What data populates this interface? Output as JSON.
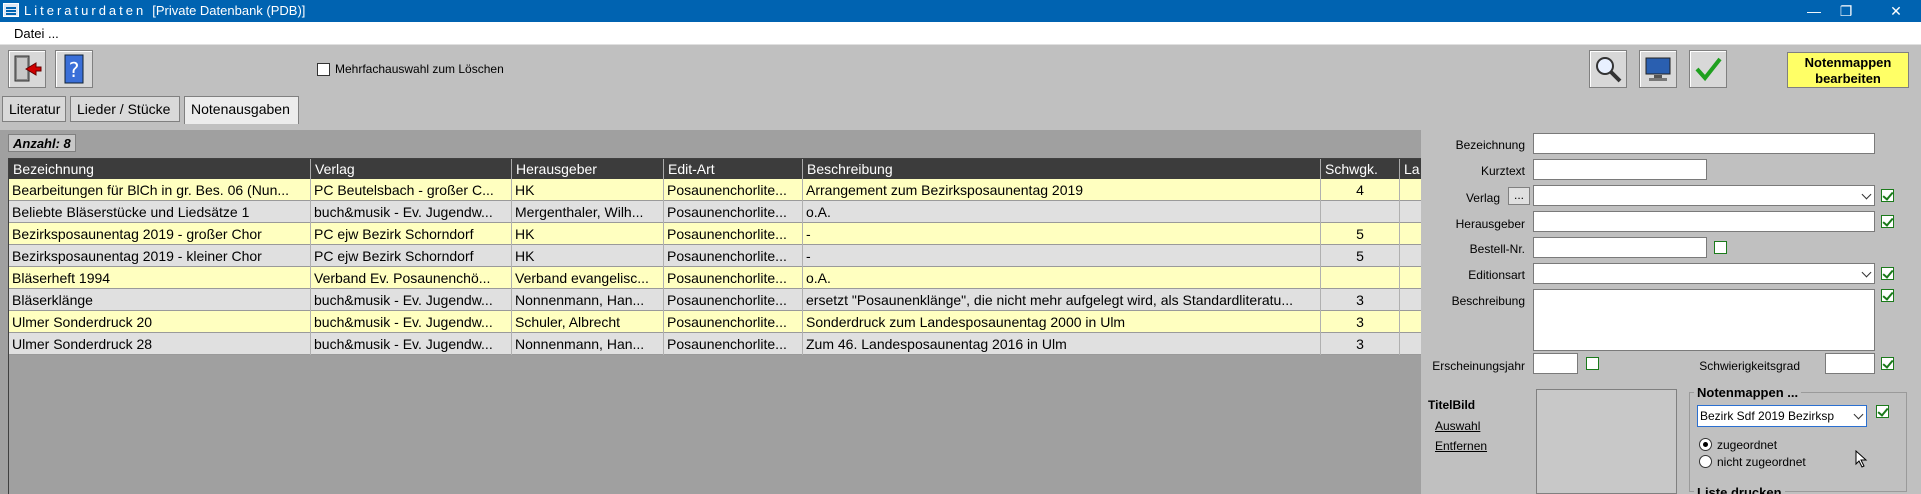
{
  "window": {
    "title": "Literaturdaten",
    "subtitle": "[Private Datenbank (PDB)]",
    "minimize": "—",
    "restore": "❐",
    "close": "✕"
  },
  "menu": {
    "datei": "Datei ..."
  },
  "toolbar": {
    "mehrfach_label": "Mehrfachauswahl zum Löschen",
    "notenmappen_button": "Notenmappen bearbeiten"
  },
  "tabs": [
    {
      "label": "Literatur"
    },
    {
      "label": "Lieder / Stücke"
    },
    {
      "label": "Notenausgaben",
      "active": true
    }
  ],
  "grid": {
    "anzahl": "Anzahl: 8",
    "columns": [
      "Bezeichnung",
      "Verlag",
      "Herausgeber",
      "Edit-Art",
      "Beschreibung",
      "Schwgk.",
      "La"
    ],
    "rows": [
      [
        "Bearbeitungen für BlCh in gr. Bes. 06 (Nun...",
        "PC Beutelsbach - großer C...",
        "HK",
        "Posaunenchorlite...",
        "Arrangement zum Bezirksposaunentag 2019",
        "4",
        ""
      ],
      [
        "Beliebte Bläserstücke und Liedsätze 1",
        "buch&musik - Ev. Jugendw...",
        "Mergenthaler, Wilh...",
        "Posaunenchorlite...",
        "o.A.",
        "",
        ""
      ],
      [
        "Bezirksposaunentag 2019 - großer Chor",
        "PC ejw Bezirk Schorndorf",
        "HK",
        "Posaunenchorlite...",
        "-",
        "5",
        ""
      ],
      [
        "Bezirksposaunentag 2019 - kleiner Chor",
        "PC ejw Bezirk Schorndorf",
        "HK",
        "Posaunenchorlite...",
        "-",
        "5",
        ""
      ],
      [
        "Bläserheft 1994",
        "Verband Ev. Posaunenchö...",
        "Verband evangelisc...",
        "Posaunenchorlite...",
        "o.A.",
        "",
        ""
      ],
      [
        "Bläserklänge",
        "buch&musik - Ev. Jugendw...",
        "Nonnenmann, Han...",
        "Posaunenchorlite...",
        "ersetzt \"Posaunenklänge\", die nicht mehr aufgelegt wird, als Standardliteratu...",
        "3",
        ""
      ],
      [
        "Ulmer Sonderdruck 20",
        "buch&musik - Ev. Jugendw...",
        "Schuler, Albrecht",
        "Posaunenchorlite...",
        "Sonderdruck zum Landesposaunentag 2000 in Ulm",
        "3",
        ""
      ],
      [
        "Ulmer Sonderdruck 28",
        "buch&musik - Ev. Jugendw...",
        "Nonnenmann, Han...",
        "Posaunenchorlite...",
        "Zum 46. Landesposaunentag 2016 in Ulm",
        "3",
        ""
      ]
    ],
    "row_colors": [
      "#ffffc0",
      "#e0e0e0"
    ]
  },
  "form": {
    "bezeichnung": "Bezeichnung",
    "kurztext": "Kurztext",
    "verlag": "Verlag",
    "verlag_dots": "...",
    "herausgeber": "Herausgeber",
    "bestell_nr": "Bestell-Nr.",
    "editionsart": "Editionsart",
    "beschreibung": "Beschreibung",
    "erscheinungsjahr": "Erscheinungsjahr",
    "schwierigkeitsgrad": "Schwierigkeitsgrad",
    "titelbild": "TitelBild",
    "auswahl": "Auswahl",
    "entfernen": "Entfernen",
    "notenmappen_group": "Notenmappen ...",
    "notenmappen_value": "Bezirk Sdf 2019 Bezirksp",
    "zugeordnet": "zugeordnet",
    "nicht_zugeordnet": "nicht zugeordnet",
    "liste_drucken": "Liste drucken"
  },
  "colors": {
    "titlebar": "#0063b1",
    "accent_yellow": "#ffff66",
    "check_green": "#1b7a1b"
  }
}
